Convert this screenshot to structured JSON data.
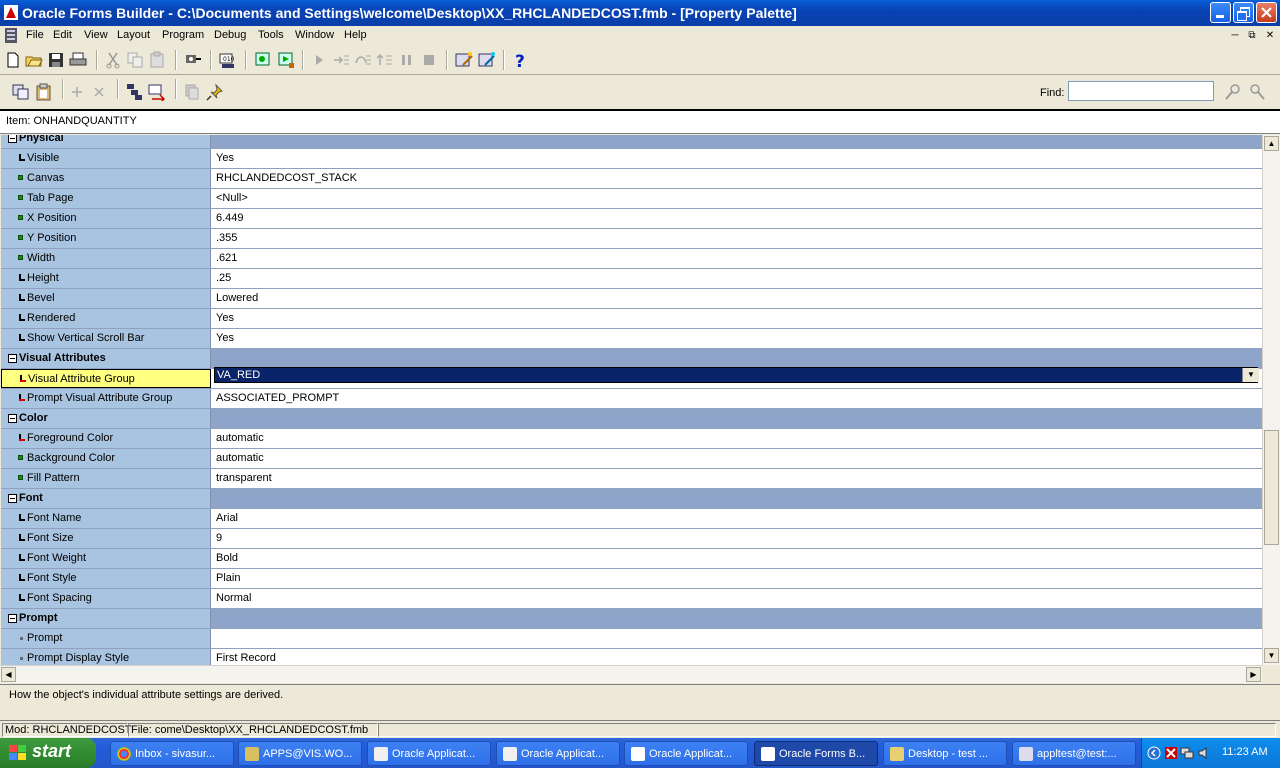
{
  "window": {
    "title": "Oracle Forms Builder - C:\\Documents and Settings\\welcome\\Desktop\\XX_RHCLANDEDCOST.fmb - [Property Palette]"
  },
  "menu": [
    "File",
    "Edit",
    "View",
    "Layout",
    "Program",
    "Debug",
    "Tools",
    "Window",
    "Help"
  ],
  "find": {
    "label": "Find:",
    "value": ""
  },
  "item_label": "Item: ONHANDQUANTITY",
  "properties": [
    {
      "type": "cat",
      "name": "Physical"
    },
    {
      "type": "prop",
      "ind": "arrow",
      "name": "Visible",
      "value": "Yes"
    },
    {
      "type": "prop",
      "ind": "green",
      "name": "Canvas",
      "value": "RHCLANDEDCOST_STACK"
    },
    {
      "type": "prop",
      "ind": "green",
      "name": "Tab Page",
      "value": "<Null>"
    },
    {
      "type": "prop",
      "ind": "green",
      "name": "X Position",
      "value": "6.449"
    },
    {
      "type": "prop",
      "ind": "green",
      "name": "Y Position",
      "value": ".355"
    },
    {
      "type": "prop",
      "ind": "green",
      "name": "Width",
      "value": ".621"
    },
    {
      "type": "prop",
      "ind": "arrow",
      "name": "Height",
      "value": ".25"
    },
    {
      "type": "prop",
      "ind": "arrow",
      "name": "Bevel",
      "value": "Lowered"
    },
    {
      "type": "prop",
      "ind": "arrow",
      "name": "Rendered",
      "value": "Yes"
    },
    {
      "type": "prop",
      "ind": "arrow",
      "name": "Show Vertical Scroll Bar",
      "value": "Yes"
    },
    {
      "type": "cat",
      "name": "Visual Attributes"
    },
    {
      "type": "prop",
      "ind": "arrowred",
      "name": "Visual Attribute Group",
      "value": "VA_RED",
      "selected": true
    },
    {
      "type": "prop",
      "ind": "arrowred",
      "name": "Prompt Visual Attribute Group",
      "value": "ASSOCIATED_PROMPT"
    },
    {
      "type": "cat",
      "name": "Color"
    },
    {
      "type": "prop",
      "ind": "arrowred",
      "name": "Foreground Color",
      "value": "automatic"
    },
    {
      "type": "prop",
      "ind": "green",
      "name": "Background Color",
      "value": "automatic"
    },
    {
      "type": "prop",
      "ind": "green",
      "name": "Fill Pattern",
      "value": "transparent"
    },
    {
      "type": "cat",
      "name": "Font"
    },
    {
      "type": "prop",
      "ind": "arrow",
      "name": "Font Name",
      "value": "Arial"
    },
    {
      "type": "prop",
      "ind": "arrow",
      "name": "Font Size",
      "value": "9"
    },
    {
      "type": "prop",
      "ind": "arrow",
      "name": "Font Weight",
      "value": "Bold"
    },
    {
      "type": "prop",
      "ind": "arrow",
      "name": "Font Style",
      "value": "Plain"
    },
    {
      "type": "prop",
      "ind": "arrow",
      "name": "Font Spacing",
      "value": "Normal"
    },
    {
      "type": "cat",
      "name": "Prompt"
    },
    {
      "type": "prop",
      "ind": "dot",
      "name": "Prompt",
      "value": ""
    },
    {
      "type": "prop",
      "ind": "dot",
      "name": "Prompt Display Style",
      "value": "First Record"
    }
  ],
  "hint": "How the object's individual attribute settings are derived.",
  "status": {
    "module": "Mod: RHCLANDEDCOST",
    "file": "File: come\\Desktop\\XX_RHCLANDEDCOST.fmb"
  },
  "taskbar": {
    "start": "start",
    "tasks": [
      {
        "label": "Inbox - sivasur...",
        "icon": "chrome-icon"
      },
      {
        "label": "APPS@VIS.WO...",
        "icon": "sqlplus-icon"
      },
      {
        "label": "Oracle Applicat...",
        "icon": "oracle-app-icon"
      },
      {
        "label": "Oracle Applicat...",
        "icon": "oracle-app-icon"
      },
      {
        "label": "Oracle Applicat...",
        "icon": "java-icon"
      },
      {
        "label": "Oracle Forms B...",
        "icon": "forms-icon",
        "active": true
      },
      {
        "label": "Desktop - test ...",
        "icon": "explorer-icon"
      },
      {
        "label": "appltest@test:...",
        "icon": "putty-icon"
      }
    ],
    "clock": "11:23 AM"
  }
}
